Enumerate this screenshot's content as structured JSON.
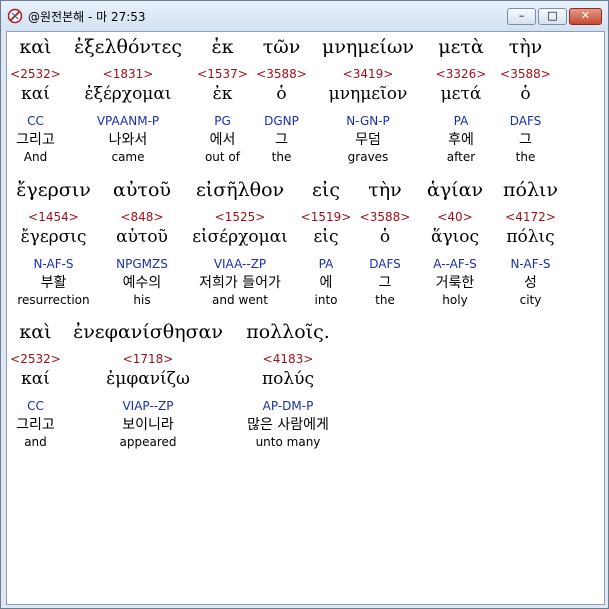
{
  "window": {
    "title": "@원전본해 - 마 27:53",
    "minimize_label": "–",
    "maximize_label": "□",
    "close_label": "✕"
  },
  "rows": [
    {
      "words": [
        {
          "greek": "καὶ",
          "strong": "<2532>",
          "lemma": "καί",
          "morph": "CC",
          "korean": "그리고",
          "english": "And"
        },
        {
          "greek": "ἐξελθόντες",
          "strong": "<1831>",
          "lemma": "ἐξέρχομαι",
          "morph": "VPAANM-P",
          "korean": "나와서",
          "english": "came"
        },
        {
          "greek": "ἐκ",
          "strong": "<1537>",
          "lemma": "ἐκ",
          "morph": "PG",
          "korean": "에서",
          "english": "out of"
        },
        {
          "greek": "τῶν",
          "strong": "<3588>",
          "lemma": "ὁ",
          "morph": "DGNP",
          "korean": "그",
          "english": "the"
        },
        {
          "greek": "μνημείων",
          "strong": "<3419>",
          "lemma": "μνημεῖον",
          "morph": "N-GN-P",
          "korean": "무덤",
          "english": "graves"
        },
        {
          "greek": "μετὰ",
          "strong": "<3326>",
          "lemma": "μετά",
          "morph": "PA",
          "korean": "후에",
          "english": "after"
        },
        {
          "greek": "τὴν",
          "strong": "<3588>",
          "lemma": "ὁ",
          "morph": "DAFS",
          "korean": "그",
          "english": "the"
        }
      ]
    },
    {
      "words": [
        {
          "greek": "ἔγερσιν",
          "strong": "<1454>",
          "lemma": "ἔγερσις",
          "morph": "N-AF-S",
          "korean": "부활",
          "english": "resurrection"
        },
        {
          "greek": "αὐτοῦ",
          "strong": "<848>",
          "lemma": "αὑτοῦ",
          "morph": "NPGMZS",
          "korean": "예수의",
          "english": "his"
        },
        {
          "greek": "εἰσῆλθον",
          "strong": "<1525>",
          "lemma": "εἰσέρχομαι",
          "morph": "VIAA--ZP",
          "korean": "저희가 들어가",
          "english": "and went"
        },
        {
          "greek": "εἰς",
          "strong": "<1519>",
          "lemma": "εἰς",
          "morph": "PA",
          "korean": "에",
          "english": "into"
        },
        {
          "greek": "τὴν",
          "strong": "<3588>",
          "lemma": "ὁ",
          "morph": "DAFS",
          "korean": "그",
          "english": "the"
        },
        {
          "greek": "ἁγίαν",
          "strong": "<40>",
          "lemma": "ἅγιος",
          "morph": "A--AF-S",
          "korean": "거룩한",
          "english": "holy"
        },
        {
          "greek": "πόλιν",
          "strong": "<4172>",
          "lemma": "πόλις",
          "morph": "N-AF-S",
          "korean": "성",
          "english": "city"
        }
      ]
    },
    {
      "words": [
        {
          "greek": "καὶ",
          "strong": "<2532>",
          "lemma": "καί",
          "morph": "CC",
          "korean": "그리고",
          "english": "and"
        },
        {
          "greek": "ἐνεφανίσθησαν",
          "strong": "<1718>",
          "lemma": "ἐμφανίζω",
          "morph": "VIAP--ZP",
          "korean": "보이니라",
          "english": "appeared"
        },
        {
          "greek": "πολλοῖς.",
          "strong": "<4183>",
          "lemma": "πολύς",
          "morph": "AP-DM-P",
          "korean": "많은 사람에게",
          "english": "unto many"
        }
      ]
    }
  ]
}
